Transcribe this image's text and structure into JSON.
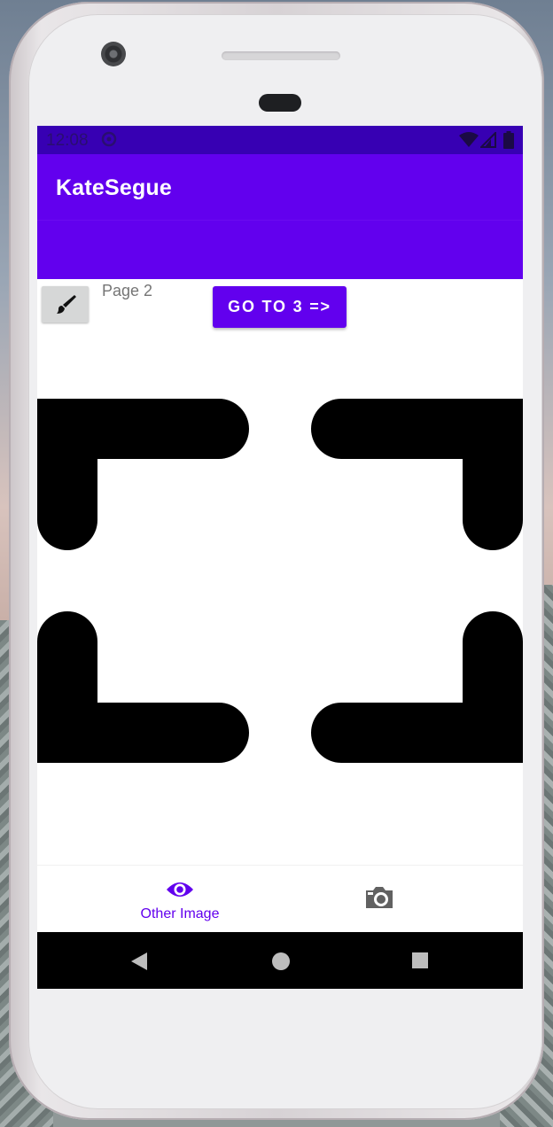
{
  "status_bar": {
    "time": "12:08",
    "sync_icon": "sync-icon",
    "wifi_icon": "wifi-icon",
    "signal_icon": "signal-icon",
    "battery_icon": "battery-icon"
  },
  "app_bar": {
    "title": "KateSegue",
    "color": "#6200ee",
    "status_color": "#3700b3"
  },
  "content": {
    "brush_icon": "paint-brush-icon",
    "page_label": "Page 2",
    "go_button_label": "GO TO 3 =>",
    "main_image": "fullscreen-frame-icon"
  },
  "bottom_nav": {
    "items": [
      {
        "icon": "eye-icon",
        "label": "Other Image",
        "selected": true
      },
      {
        "icon": "camera-icon",
        "label": "",
        "selected": false
      }
    ],
    "active_color": "#6200ee",
    "inactive_color": "#616161"
  },
  "system_nav": {
    "back": "back-triangle-icon",
    "home": "home-circle-icon",
    "recents": "recents-square-icon"
  }
}
